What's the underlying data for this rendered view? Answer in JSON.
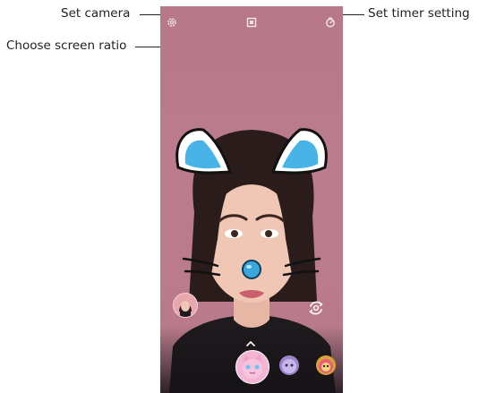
{
  "callouts": {
    "set_camera": "Set camera",
    "choose_ratio": "Choose screen ratio",
    "set_timer": "Set timer setting"
  },
  "icons": {
    "settings": "gear-icon",
    "ratio": "screen-ratio-icon",
    "timer": "timer-icon",
    "switch_camera": "switch-camera-icon",
    "expand": "chevron-up-icon"
  },
  "stickers": [
    "cat-face-sticker",
    "purple-character-sticker",
    "bear-character-sticker"
  ],
  "colors": {
    "background": "#b87a8a",
    "ear_blue": "#47b3e6",
    "nose_blue": "#3aa6dc"
  }
}
